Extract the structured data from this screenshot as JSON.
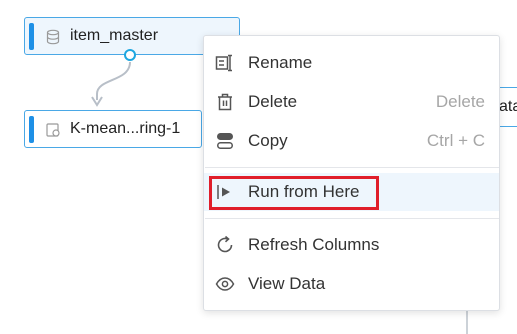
{
  "canvas": {
    "nodes": [
      {
        "label": "item_master",
        "icon": "database-icon",
        "selected": true
      },
      {
        "label": "K-mean...ring-1",
        "icon": "model-icon",
        "selected": false
      }
    ],
    "partial_node_text": "ata"
  },
  "context_menu": {
    "items": [
      {
        "label": "Rename",
        "icon": "rename-icon",
        "shortcut": ""
      },
      {
        "label": "Delete",
        "icon": "trash-icon",
        "shortcut": "Delete"
      },
      {
        "label": "Copy",
        "icon": "copy-icon",
        "shortcut": "Ctrl + C"
      },
      {
        "label": "Run from Here",
        "icon": "play-icon",
        "shortcut": "",
        "highlighted": true
      },
      {
        "label": "Refresh Columns",
        "icon": "refresh-icon",
        "shortcut": ""
      },
      {
        "label": "View Data",
        "icon": "eye-icon",
        "shortcut": ""
      }
    ]
  },
  "colors": {
    "accent": "#1e90e6",
    "node_border": "#4aa8e6",
    "highlight_bg": "#eef6fd",
    "annotation": "#e01e2a"
  }
}
